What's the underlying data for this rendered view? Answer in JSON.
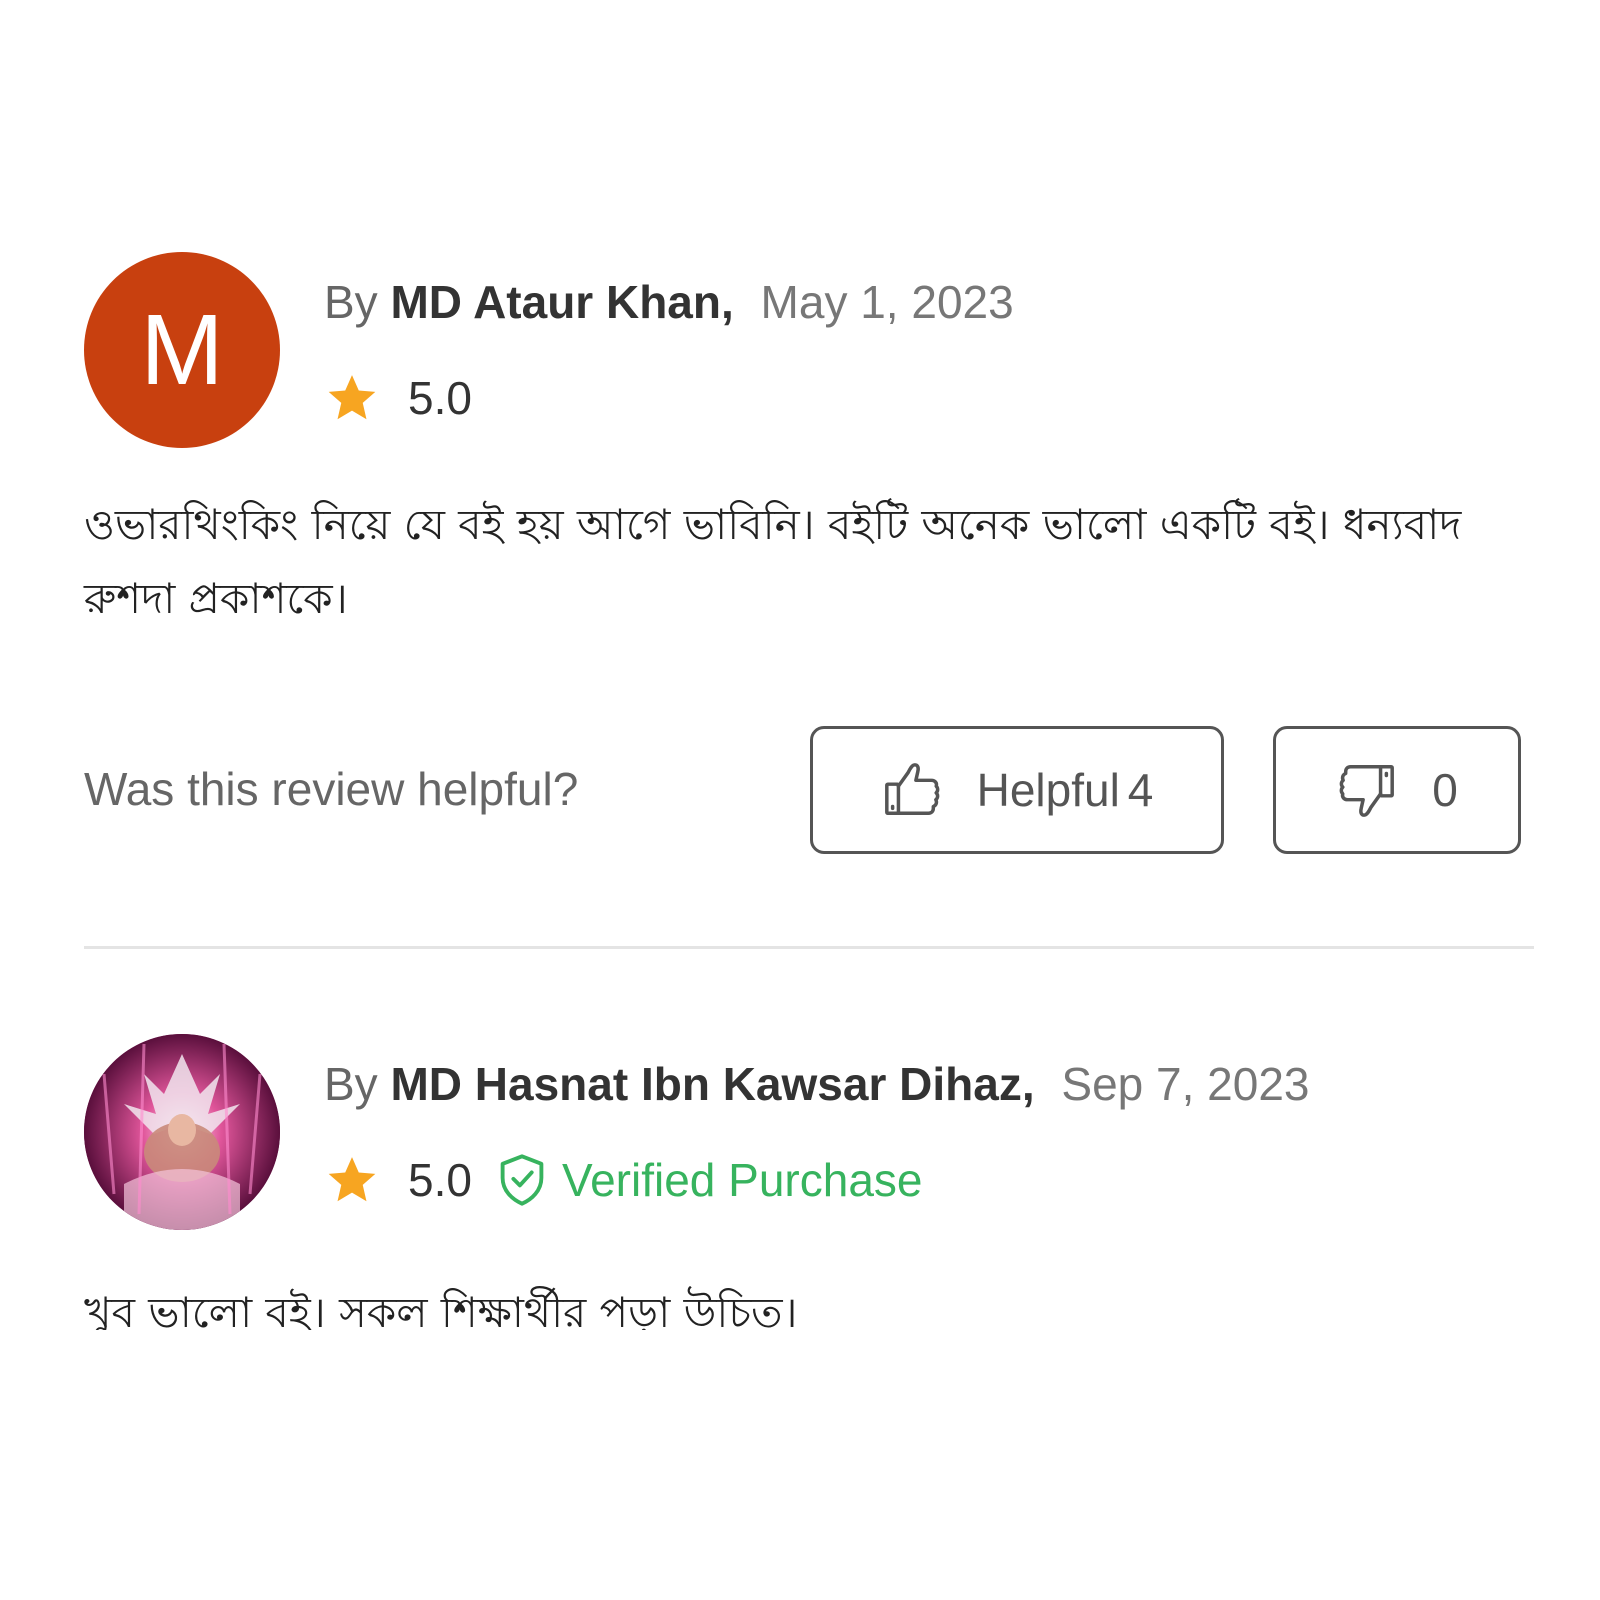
{
  "reviews": [
    {
      "avatar_letter": "M",
      "avatar_color": "#c8400f",
      "by_label": "By",
      "author": "MD Ataur Khan,",
      "date": "May 1, 2023",
      "rating": "5.0",
      "star_icon": "star-icon",
      "body": "ওভারথিংকিং নিয়ে যে বই হয় আগে ভাবিনি। বইটি অনেক ভালো একটি বই। ধন্যবাদ রুশদা প্রকাশকে।"
    },
    {
      "avatar_letter": "",
      "by_label": "By",
      "author": "MD Hasnat Ibn Kawsar Dihaz,",
      "date": "Sep 7, 2023",
      "rating": "5.0",
      "star_icon": "star-icon",
      "verified_label": "Verified Purchase",
      "verified_icon": "shield-check-icon",
      "body": "খুব ভালো বই। সকল শিক্ষার্থীর পড়া উচিত।"
    }
  ],
  "helpful": {
    "question": "Was this review helpful?",
    "helpful_label": "Helpful",
    "helpful_count": "4",
    "unhelpful_count": "0",
    "thumb_up_icon": "thumbs-up-icon",
    "thumb_down_icon": "thumbs-down-icon"
  },
  "colors": {
    "star": "#f7a521",
    "verified": "#37b35e",
    "avatar_bg": "#c8400f"
  }
}
